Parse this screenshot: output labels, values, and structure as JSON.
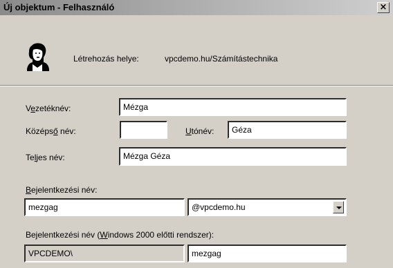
{
  "window": {
    "title": "Új objektum - Felhasználó",
    "close_glyph": "×"
  },
  "location": {
    "label": "Létrehozás helye:",
    "value": "vpcdemo.hu/Számítástechnika"
  },
  "icon": "user-icon",
  "form": {
    "last_name": {
      "label_pre": "V",
      "label_ul": "e",
      "label_post": "zetéknév:",
      "value": "Mézga"
    },
    "middle_name": {
      "label_pre": "Középs",
      "label_ul": "ő",
      "label_post": " név:",
      "value": ""
    },
    "first_name": {
      "label_pre": "",
      "label_ul": "U",
      "label_post": "tónév:",
      "value": "Géza"
    },
    "full_name": {
      "label_pre": "Te",
      "label_ul": "l",
      "label_post": "jes név:",
      "value": "Mézga Géza"
    },
    "logon_name": {
      "label_pre": "",
      "label_ul": "B",
      "label_post": "ejelentkezési név:",
      "value": "mezgag"
    },
    "domain_select": {
      "value": "@vpcdemo.hu"
    },
    "pre2000_logon": {
      "label_pre": "Bejelentkezési név (",
      "label_ul": "W",
      "label_post": "indows 2000 előtti rendszer):",
      "domain_value": "VPCDEMO\\",
      "user_value": "mezgag"
    }
  }
}
